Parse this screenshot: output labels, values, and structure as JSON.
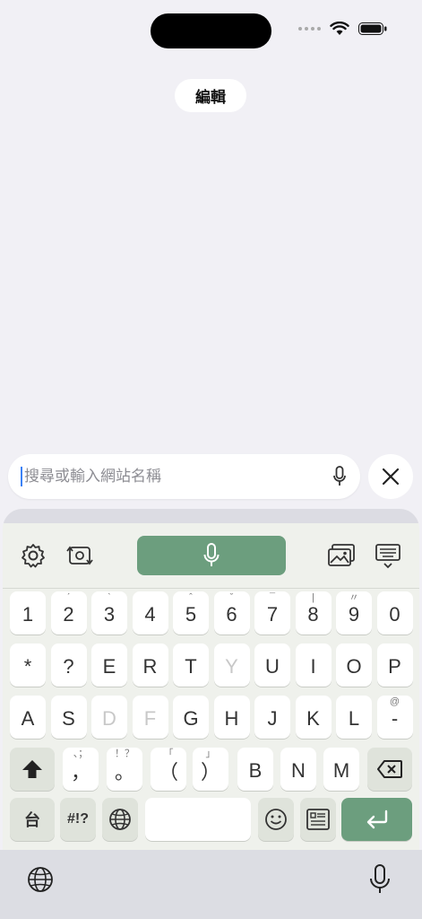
{
  "header": {
    "edit_label": "編輯"
  },
  "search": {
    "placeholder": "搜尋或輸入網站名稱",
    "value": ""
  },
  "keyboard": {
    "row1": [
      {
        "main": "1",
        "hint": ""
      },
      {
        "main": "2",
        "hint": "ˊ"
      },
      {
        "main": "3",
        "hint": "ˋ"
      },
      {
        "main": "4",
        "hint": ""
      },
      {
        "main": "5",
        "hint": "ˆ"
      },
      {
        "main": "6",
        "hint": "ˇ"
      },
      {
        "main": "7",
        "hint": "¯"
      },
      {
        "main": "8",
        "hint": "|"
      },
      {
        "main": "9",
        "hint": "〃"
      },
      {
        "main": "0",
        "hint": ""
      }
    ],
    "row2": [
      {
        "main": "*",
        "hint": ""
      },
      {
        "main": "?",
        "hint": ""
      },
      {
        "main": "E",
        "hint": ""
      },
      {
        "main": "R",
        "hint": ""
      },
      {
        "main": "T",
        "hint": ""
      },
      {
        "main": "Y",
        "hint": ""
      },
      {
        "main": "U",
        "hint": ""
      },
      {
        "main": "I",
        "hint": ""
      },
      {
        "main": "O",
        "hint": ""
      },
      {
        "main": "P",
        "hint": ""
      }
    ],
    "row3": [
      {
        "main": "A",
        "hint": ""
      },
      {
        "main": "S",
        "hint": ""
      },
      {
        "main": "D",
        "hint": ""
      },
      {
        "main": "F",
        "hint": ""
      },
      {
        "main": "G",
        "hint": ""
      },
      {
        "main": "H",
        "hint": ""
      },
      {
        "main": "J",
        "hint": ""
      },
      {
        "main": "K",
        "hint": ""
      },
      {
        "main": "L",
        "hint": ""
      },
      {
        "main": "-",
        "hint": "@"
      }
    ],
    "row4": [
      {
        "main": "，",
        "hint": "、；"
      },
      {
        "main": "。",
        "hint": "！？"
      },
      {
        "main": "（",
        "hint": "「"
      },
      {
        "main": "）",
        "hint": "」"
      },
      {
        "main": "B",
        "hint": ""
      },
      {
        "main": "N",
        "hint": ""
      },
      {
        "main": "M",
        "hint": ""
      }
    ],
    "row5": {
      "lang_key": "台",
      "symbols_key": "#!?"
    }
  },
  "colors": {
    "accent": "#6c9e7e",
    "caret": "#3b82f6",
    "background": "#f1f0f5"
  }
}
